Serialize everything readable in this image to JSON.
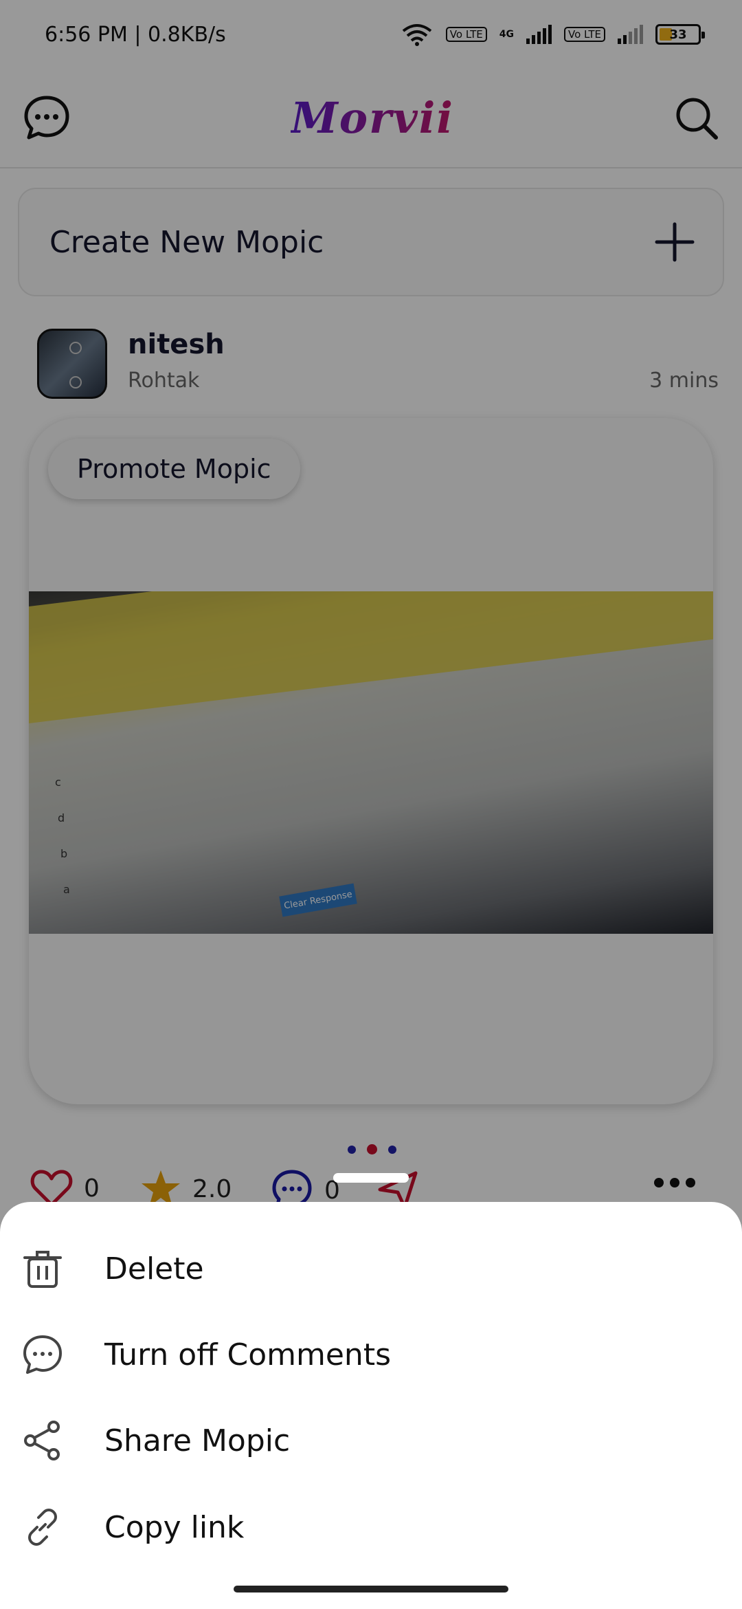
{
  "status_bar": {
    "time_speed": "6:56 PM | 0.8KB/s",
    "sim1_badge": "Vo LTE",
    "network_type": "4G",
    "sim2_badge": "Vo LTE",
    "battery_level": "33",
    "battery_color": "#f2b21b"
  },
  "app_bar": {
    "logo": "Morvii",
    "chat_icon": "chat-bubble-icon",
    "search_icon": "search-icon"
  },
  "create": {
    "label": "Create New Mopic",
    "icon": "plus-icon"
  },
  "post": {
    "username": "nitesh",
    "location": "Rohtak",
    "time_ago": "3 mins",
    "promote_label": "Promote Mopic",
    "photo_options": [
      "c",
      "d",
      "b",
      "a"
    ],
    "photo_button": "Clear Response",
    "carousel_pages": 3,
    "carousel_active": 1
  },
  "actions": {
    "likes": "0",
    "rating": "2.0",
    "comments": "0",
    "like_color": "#c8102e",
    "star_color": "#e8a20c",
    "comment_color": "#1a1aa6"
  },
  "sheet": {
    "items": [
      {
        "label": "Delete",
        "icon": "trash-icon"
      },
      {
        "label": "Turn off Comments",
        "icon": "comment-icon"
      },
      {
        "label": "Share Mopic",
        "icon": "share-icon"
      },
      {
        "label": "Copy link",
        "icon": "link-icon"
      }
    ]
  }
}
